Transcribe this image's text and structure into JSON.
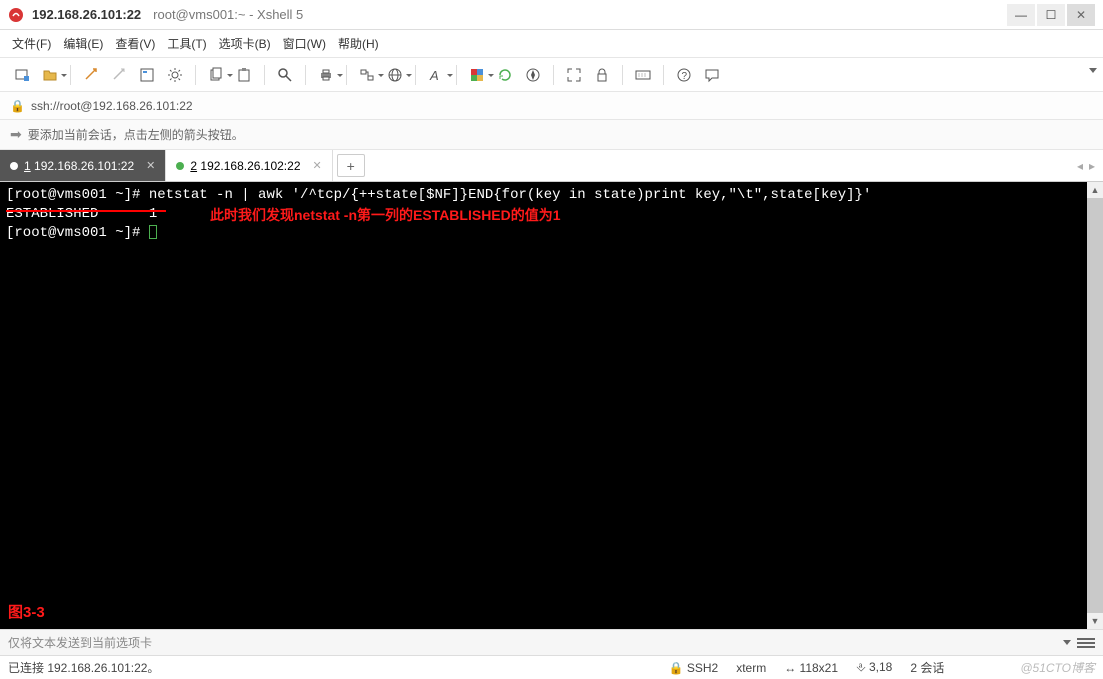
{
  "titlebar": {
    "main": "192.168.26.101:22",
    "sub": "root@vms001:~ - Xshell 5"
  },
  "menu": {
    "file": "文件(F)",
    "edit": "编辑(E)",
    "view": "查看(V)",
    "tools": "工具(T)",
    "tabs": "选项卡(B)",
    "window": "窗口(W)",
    "help": "帮助(H)"
  },
  "addressbar": {
    "url": "ssh://root@192.168.26.101:22"
  },
  "hintbar": {
    "text": "要添加当前会话，点击左侧的箭头按钮。"
  },
  "tabs": [
    {
      "num": "1",
      "label": "192.168.26.101:22",
      "active": true
    },
    {
      "num": "2",
      "label": "192.168.26.102:22",
      "active": false
    }
  ],
  "terminal": {
    "prompt1": "[root@vms001 ~]# ",
    "cmd": "netstat -n | awk '/^tcp/{++state[$NF]}END{for(key in state)print key,\"\\t\",state[key]}'",
    "outState": "ESTABLISHED",
    "outVal": "1",
    "prompt2": "[root@vms001 ~]# ",
    "annotation": "此时我们发现netstat -n第一列的ESTABLISHED的值为1",
    "figure": "图3-3"
  },
  "sendbar": {
    "placeholder": "仅将文本发送到当前选项卡"
  },
  "status": {
    "connected": "已连接 192.168.26.101:22。",
    "proto": "SSH2",
    "term": "xterm",
    "size": "118x21",
    "pos": "3,18",
    "sessions": "2 会话"
  },
  "watermark": "@51CTO博客"
}
